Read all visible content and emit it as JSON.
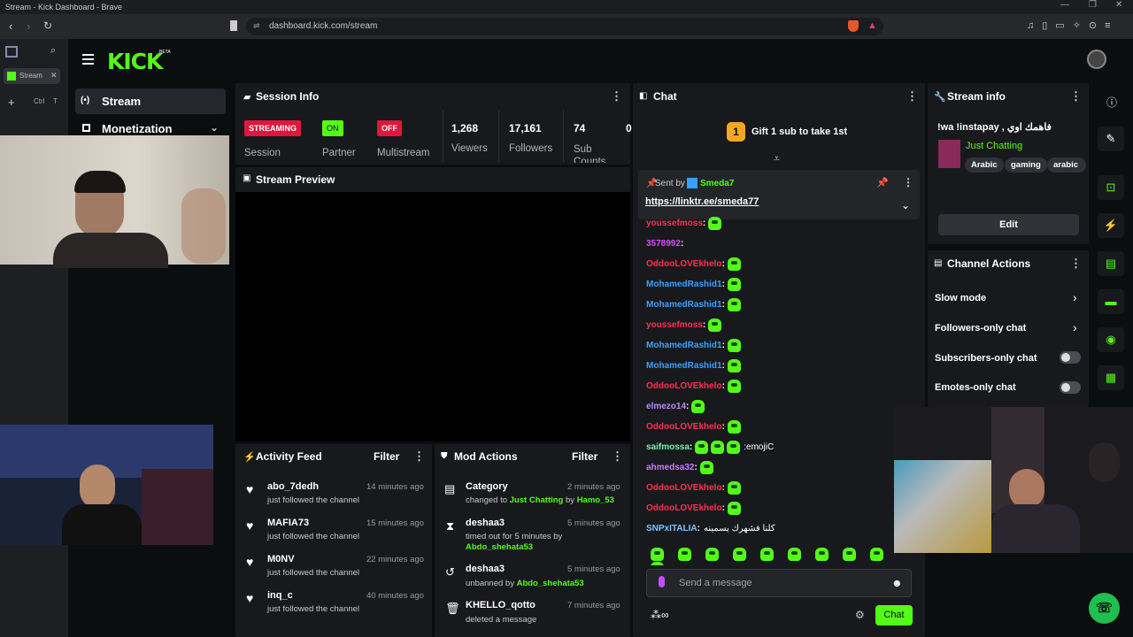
{
  "browser": {
    "title": "Stream - Kick Dashboard - Brave",
    "url": "dashboard.kick.com/stream",
    "tab_label": "Stream",
    "shortcut_ctrl": "Ctrl",
    "shortcut_t": "T"
  },
  "brand": {
    "logo": "KICK",
    "beta": "BETA",
    "accent": "#53fc18"
  },
  "nav": {
    "stream": "Stream",
    "monetization": "Monetization"
  },
  "session": {
    "title": "Session Info",
    "streaming": "STREAMING",
    "session_label": "Session",
    "on": "ON",
    "partner_label": "Partner",
    "off": "OFF",
    "multistream_label": "Multistream",
    "viewers": "1,268",
    "viewers_label": "Viewers",
    "followers": "17,161",
    "followers_label": "Followers",
    "subs": "74",
    "subs_label": "Sub Counts",
    "next": "0"
  },
  "preview": {
    "title": "Stream Preview"
  },
  "activity": {
    "title": "Activity Feed",
    "filter": "Filter",
    "items": [
      {
        "name": "abo_7dedh",
        "sub": "just followed the channel",
        "time": "14 minutes ago"
      },
      {
        "name": "MAFIA73",
        "sub": "just followed the channel",
        "time": "15 minutes ago"
      },
      {
        "name": "M0NV",
        "sub": "just followed the channel",
        "time": "22 minutes ago"
      },
      {
        "name": "inq_c",
        "sub": "just followed the channel",
        "time": "40 minutes ago"
      }
    ]
  },
  "mod": {
    "title": "Mod Actions",
    "filter": "Filter",
    "items": [
      {
        "name": "Category",
        "pre": "changed to",
        "hl1": "Just Chatting",
        "mid": "by",
        "hl2": "Hamo_53",
        "time": "2 minutes ago"
      },
      {
        "name": "deshaa3",
        "pre": "timed out for 5 minutes by",
        "hl1": "Abdo_shehata53",
        "time": "5 minutes ago"
      },
      {
        "name": "deshaa3",
        "pre": "unbanned by",
        "hl1": "Abdo_shehata53",
        "time": "5 minutes ago"
      },
      {
        "name": "KHELLO_qotto",
        "pre": "deleted a message",
        "time": "7 minutes ago"
      }
    ]
  },
  "chat": {
    "title": "Chat",
    "gift_num": "1",
    "gift_text": "Gift 1 sub to take 1st",
    "pinned_by": "Sent by",
    "pinned_user": "Smeda7",
    "pinned_link": "https://linktr.ee/smeda77",
    "placeholder": "Send a message",
    "send": "Chat",
    "messages": [
      {
        "user": "youssefmoss",
        "color": "#ff2f56",
        "emotes": 1
      },
      {
        "user": "3578992",
        "color": "#d84cff",
        "emotes": 0
      },
      {
        "user": "OddooLOVEkhelo",
        "color": "#ff2f56",
        "emotes": 1
      },
      {
        "user": "MohamedRashid1",
        "color": "#3aa0ff",
        "emotes": 1
      },
      {
        "user": "MohamedRashid1",
        "color": "#3aa0ff",
        "emotes": 1
      },
      {
        "user": "youssefmoss",
        "color": "#ff2f56",
        "emotes": 1
      },
      {
        "user": "MohamedRashid1",
        "color": "#3aa0ff",
        "emotes": 1
      },
      {
        "user": "MohamedRashid1",
        "color": "#3aa0ff",
        "emotes": 1
      },
      {
        "user": "OddooLOVEkhelo",
        "color": "#ff2f56",
        "emotes": 1
      },
      {
        "user": "elmezo14",
        "color": "#b98cff",
        "emotes": 1
      },
      {
        "user": "OddooLOVEkhelo",
        "color": "#ff2f56",
        "emotes": 1
      },
      {
        "user": "saifmossa",
        "color": "#7cf0b0",
        "emotes": 3,
        "text": ":emojiC"
      },
      {
        "user": "ahmedsa32",
        "color": "#c77dff",
        "emotes": 1
      },
      {
        "user": "OddooLOVEkhelo",
        "color": "#ff2f56",
        "emotes": 1
      },
      {
        "user": "OddooLOVEkhelo",
        "color": "#ff2f56",
        "emotes": 1
      },
      {
        "user": "SNPxITALIA",
        "color": "#7cc4ff",
        "emotes": 0,
        "text": "كلنا فشهرك يسمينه"
      }
    ]
  },
  "info": {
    "title": "Stream info",
    "stream_title": "!wa !instapay , فاهمك اوي",
    "category": "Just Chatting",
    "tags": [
      "Arabic",
      "gaming",
      "arabic"
    ],
    "edit": "Edit"
  },
  "actions": {
    "title": "Channel Actions",
    "items": [
      "Slow mode",
      "Followers-only chat",
      "Subscribers-only chat",
      "Emotes-only chat"
    ]
  }
}
